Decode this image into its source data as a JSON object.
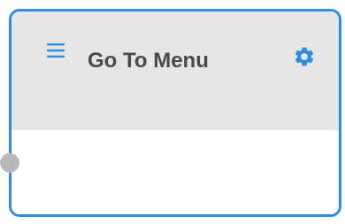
{
  "node": {
    "title": "Go To Menu",
    "menu_icon": "hamburger-menu-icon",
    "settings_icon": "gear-icon",
    "input_port": "connection-port"
  },
  "colors": {
    "accent": "#2f8ce6",
    "header_bg": "#e6e6e6",
    "title_text": "#4a4a4a",
    "port": "#b8b8b8"
  }
}
